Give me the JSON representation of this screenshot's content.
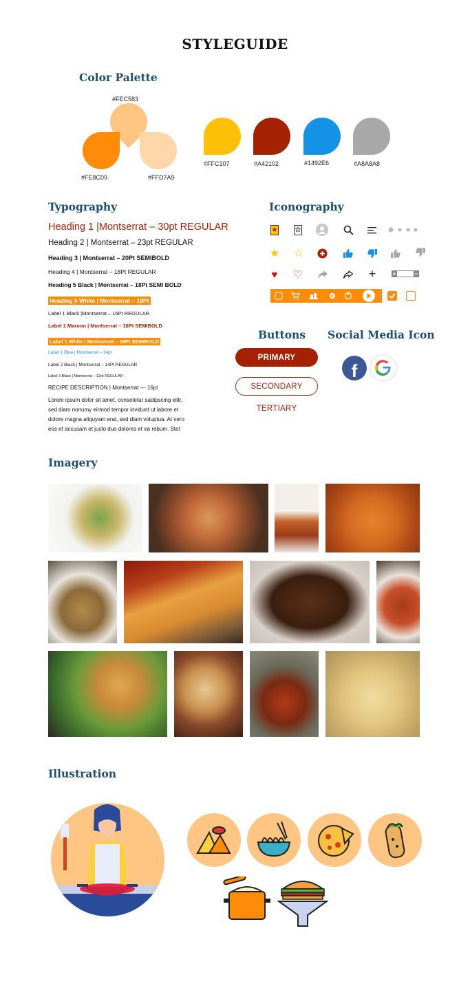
{
  "page_title": "STYLEGUIDE",
  "palette": {
    "heading": "Color Palette",
    "blob": [
      {
        "label": "#FEC583",
        "color": "#FEC583"
      },
      {
        "label": "#FE8C09",
        "color": "#FE8C09"
      },
      {
        "label": "#FFD7A9",
        "color": "#FFD7A9"
      }
    ],
    "drops": [
      {
        "label": "#FFC107",
        "color": "#FFC107"
      },
      {
        "label": "#A42102",
        "color": "#A42102"
      },
      {
        "label": "#1492E6",
        "color": "#1492E6"
      },
      {
        "label": "#A8A8A8",
        "color": "#A8A8A8"
      }
    ]
  },
  "typography": {
    "heading": "Typography",
    "h1": "Heading 1 |Montserrat – 30pt REGULAR",
    "h2": "Heading 2 | Montserrat – 23pt REGULAR",
    "h3": "Heading 3 | Montserrat – 20Pt SEMIBOLD",
    "h4": "Heading 4 | Montserrat – 18Pt  REGULAR",
    "h5b": "Heading 5 Black | Montserrat – 18Pt SEMI BOLD",
    "h5w": "Heading 5 White | Montserrat – 18Pt",
    "l1b": "Label 1 Black |Montserrat – 16Pt REGULAR",
    "l1m": "Label 1 Maroon | Montserrat – 16Pt SEMIBOLD",
    "l1w": "Label 1 White | Montserrat – 16Pt SEMIBOLD",
    "l1blue": "Label 1 Blue | Montserrat – 14pt",
    "l2": "Label 2 Black | Montserrat – 14Pt REGULAR",
    "l3": "Label 3 Black | Montserrat – 12pt REGULAR",
    "recipe": "RECIPE DESCRIPTION | Montserrat — 16pt",
    "lorem": [
      "Lorem ipsum dolor sit amet, consetetur sadipscing elitr,",
      "sed diam nonumy eirmod tempor invidunt ut labore et",
      "dolore magna aliquyam erat, sed diam voluptua. At vero",
      "eos et accusam et justo duo dolores et ea rebum. Stet"
    ]
  },
  "iconography": {
    "heading": "Iconography",
    "icons": [
      "bookmark-filled-icon",
      "bookmark-outline-icon",
      "user-avatar-icon",
      "search-icon",
      "menu-icon",
      "dots-icon",
      "star-filled-icon",
      "star-outline-icon",
      "add-circle-icon",
      "thumb-up-blue-icon",
      "thumb-down-blue-icon",
      "thumb-up-gray-icon",
      "thumb-down-gray-icon",
      "heart-filled-icon",
      "heart-outline-icon",
      "share-gray-icon",
      "share-outline-icon",
      "plus-icon",
      "quantity-stepper-icon",
      "checkbox-checked-icon",
      "checkbox-empty-icon"
    ],
    "colors": {
      "accent": "#FE8C09",
      "maroon": "#A42102",
      "blue": "#1492E6",
      "gray": "#A8A8A8",
      "yellow": "#FFC107"
    }
  },
  "buttons": {
    "heading": "Buttons",
    "primary": "PRIMARY",
    "secondary": "SECONDARY",
    "tertiary": "TERTIARY"
  },
  "social": {
    "heading": "Social Media Icon",
    "icons": [
      "facebook-icon",
      "google-icon"
    ]
  },
  "imagery": {
    "heading": "Imagery",
    "images": [
      "pasta-salad-image",
      "pizza-image",
      "spaghetti-fork-image",
      "penne-arrabbiata-image",
      "biryani-image",
      "dosa-image",
      "chocolate-cake-image",
      "meatballs-image",
      "samosa-image",
      "burrito-image",
      "curry-bowl-image",
      "penne-alfredo-image"
    ]
  },
  "illustration": {
    "heading": "Illustration",
    "items": [
      "chef-cooking-illustration",
      "samosa-icon",
      "noodle-bowl-icon",
      "pizza-icon",
      "burrito-icon",
      "cooking-pot-icon",
      "burger-funnel-icon"
    ]
  }
}
